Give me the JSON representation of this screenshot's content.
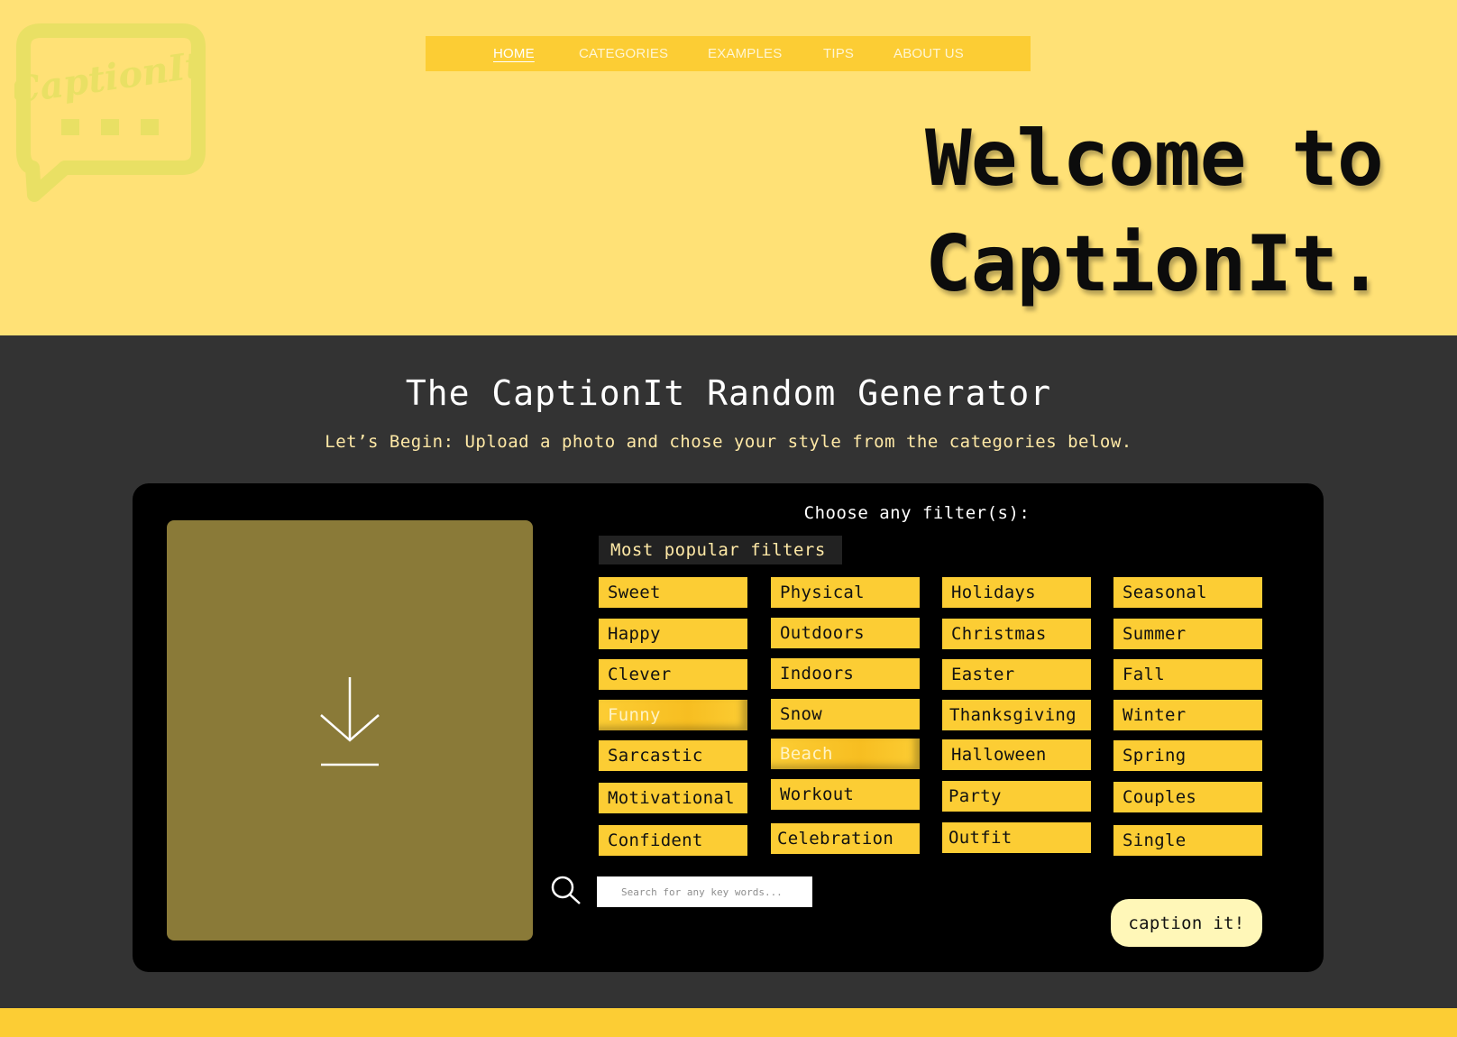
{
  "nav": {
    "items": [
      {
        "label": "HOME",
        "active": true
      },
      {
        "label": "CATEGORIES",
        "active": false
      },
      {
        "label": "EXAMPLES",
        "active": false
      },
      {
        "label": "TIPS",
        "active": false
      },
      {
        "label": "ABOUT US",
        "active": false
      }
    ]
  },
  "logo": {
    "text": "CaptionIt"
  },
  "hero": {
    "line1": "Welcome to",
    "line2": "CaptionIt."
  },
  "generator": {
    "title": "The CaptionIt Random Generator",
    "subtitle": "Let’s Begin: Upload a photo and chose your style from the categories below.",
    "choose_label": "Choose any filter(s):",
    "popular_label": "Most popular filters",
    "filters": {
      "col1": [
        {
          "label": "Sweet",
          "selected": false
        },
        {
          "label": "Happy",
          "selected": false
        },
        {
          "label": "Clever",
          "selected": false
        },
        {
          "label": "Funny",
          "selected": true
        },
        {
          "label": "Sarcastic",
          "selected": false
        },
        {
          "label": "Motivational",
          "selected": false
        },
        {
          "label": "Confident",
          "selected": false
        }
      ],
      "col2": [
        {
          "label": "Physical",
          "selected": false
        },
        {
          "label": "Outdoors",
          "selected": false
        },
        {
          "label": "Indoors",
          "selected": false
        },
        {
          "label": "Snow",
          "selected": false
        },
        {
          "label": "Beach",
          "selected": true
        },
        {
          "label": "Workout",
          "selected": false
        },
        {
          "label": "Celebration",
          "selected": false
        }
      ],
      "col3": [
        {
          "label": "Holidays",
          "selected": false
        },
        {
          "label": "Christmas",
          "selected": false
        },
        {
          "label": "Easter",
          "selected": false
        },
        {
          "label": "Thanksgiving",
          "selected": false
        },
        {
          "label": "Halloween",
          "selected": false
        },
        {
          "label": "Party",
          "selected": false
        },
        {
          "label": "Outfit",
          "selected": false
        }
      ],
      "col4": [
        {
          "label": "Seasonal",
          "selected": false
        },
        {
          "label": "Summer",
          "selected": false
        },
        {
          "label": "Fall",
          "selected": false
        },
        {
          "label": "Winter",
          "selected": false
        },
        {
          "label": "Spring",
          "selected": false
        },
        {
          "label": "Couples",
          "selected": false
        },
        {
          "label": "Single",
          "selected": false
        }
      ]
    },
    "search": {
      "placeholder": "Search for any key words...",
      "value": ""
    },
    "caption_button": "caption it!"
  },
  "colors": {
    "header_bg": "#FFE176",
    "accent_yellow": "#FCCD34",
    "dark_bg": "#333333",
    "panel_bg": "#000000",
    "upload_bg": "#8A7A38"
  },
  "icons": {
    "upload": "download-arrow-icon",
    "search": "search-icon"
  }
}
